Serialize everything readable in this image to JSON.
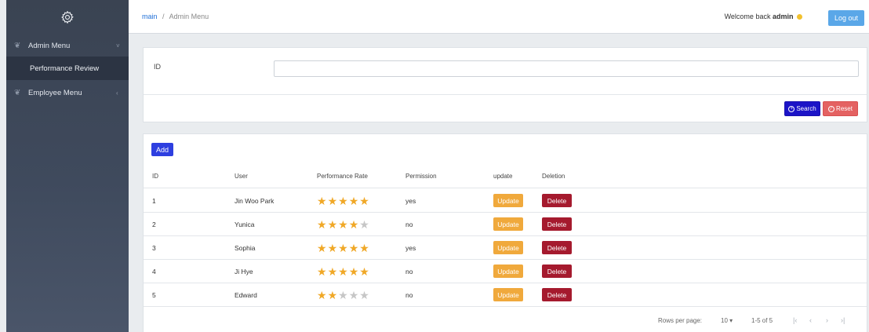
{
  "colors": {
    "sidebar": "#3f4a5d",
    "primary": "#2e3fe0",
    "search": "#1c14c7",
    "reset": "#e46262",
    "update": "#f0a93c",
    "delete": "#a51a2e",
    "logout": "#5aa7e8",
    "star_on": "#f0a827",
    "star_off": "#c6c6c6"
  },
  "sidebar": {
    "logo_icon": "gear-icon",
    "items": [
      {
        "label": "Admin Menu",
        "icon": "leaf-icon",
        "chevron": "˅"
      },
      {
        "label": "Performance Review"
      },
      {
        "label": "Employee Menu",
        "icon": "leaf-icon",
        "chevron": "‹"
      }
    ]
  },
  "header": {
    "breadcrumb_root": "main",
    "breadcrumb_sep": "/",
    "breadcrumb_current": "Admin Menu",
    "welcome_prefix": "Welcome back",
    "username": "admin",
    "logout_label": "Log out"
  },
  "search": {
    "id_label": "ID",
    "id_value": "",
    "search_label": "Search",
    "reset_label": "Reset"
  },
  "table": {
    "add_label": "Add",
    "columns": [
      "ID",
      "User",
      "Performance Rate",
      "Permission",
      "update",
      "Deletion"
    ],
    "update_label": "Update",
    "delete_label": "Delete",
    "rows": [
      {
        "id": "1",
        "user": "Jin Woo Park",
        "rating": 5,
        "permission": "yes"
      },
      {
        "id": "2",
        "user": "Yunica",
        "rating": 4,
        "permission": "no"
      },
      {
        "id": "3",
        "user": "Sophia",
        "rating": 5,
        "permission": "yes"
      },
      {
        "id": "4",
        "user": "Ji Hye",
        "rating": 5,
        "permission": "no"
      },
      {
        "id": "5",
        "user": "Edward",
        "rating": 2,
        "permission": "no"
      }
    ],
    "rating_max": 5
  },
  "pagination": {
    "rows_per_page_label": "Rows per page:",
    "rows_per_page": "10",
    "range": "1-5 of 5"
  }
}
